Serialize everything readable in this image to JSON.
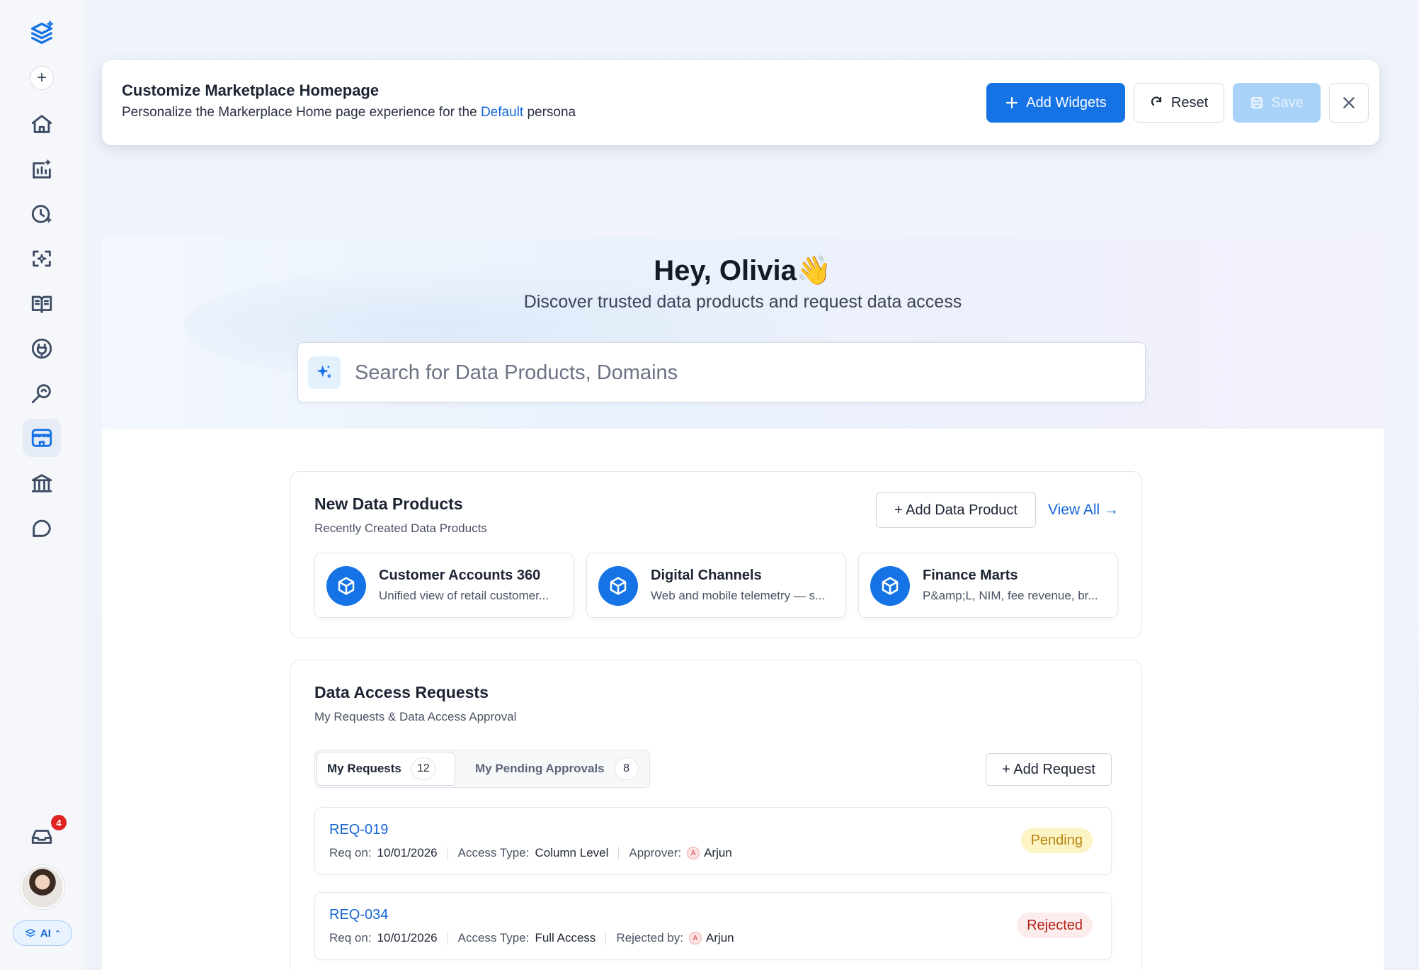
{
  "customize": {
    "title": "Customize Marketplace Homepage",
    "subtitle_prefix": "Personalize the Markerplace Home page experience for the",
    "persona": "Default",
    "subtitle_suffix": "persona",
    "add_widgets_label": "Add Widgets",
    "reset_label": "Reset",
    "save_label": "Save"
  },
  "hero": {
    "greeting": "Hey, Olivia",
    "wave": "👋",
    "tagline": "Discover trusted data products and request data access",
    "search_placeholder": "Search for Data Products, Domains"
  },
  "new_products": {
    "title": "New Data Products",
    "subtitle": "Recently Created Data Products",
    "add_label": "+ Add Data Product",
    "view_all_label": "View All →",
    "items": [
      {
        "name": "Customer Accounts 360",
        "desc": "Unified view of retail customer..."
      },
      {
        "name": "Digital Channels",
        "desc": "Web and mobile telemetry — s..."
      },
      {
        "name": "Finance Marts",
        "desc": "P&amp;L, NIM, fee revenue, br..."
      }
    ]
  },
  "access_requests": {
    "title": "Data Access Requests",
    "subtitle": "My Requests & Data Access Approval",
    "tabs": [
      {
        "label": "My Requests",
        "count": "12"
      },
      {
        "label": "My Pending Approvals",
        "count": "8"
      }
    ],
    "add_label": "+ Add Request",
    "rows": [
      {
        "id": "REQ-019",
        "req_on_label": "Req on:",
        "req_on": "10/01/2026",
        "access_label": "Access Type:",
        "access": "Column Level",
        "person_label": "Approver:",
        "person_initial": "A",
        "person": "Arjun",
        "status": "Pending"
      },
      {
        "id": "REQ-034",
        "req_on_label": "Req on:",
        "req_on": "10/01/2026",
        "access_label": "Access Type:",
        "access": "Full Access",
        "person_label": "Rejected by:",
        "person_initial": "A",
        "person": "Arjun",
        "status": "Rejected"
      }
    ]
  },
  "sidebar": {
    "inbox_count": "4",
    "ai_label": "AI"
  },
  "colors": {
    "accent": "#1673e6",
    "pending": "#b8830b",
    "rejected": "#b42318"
  }
}
